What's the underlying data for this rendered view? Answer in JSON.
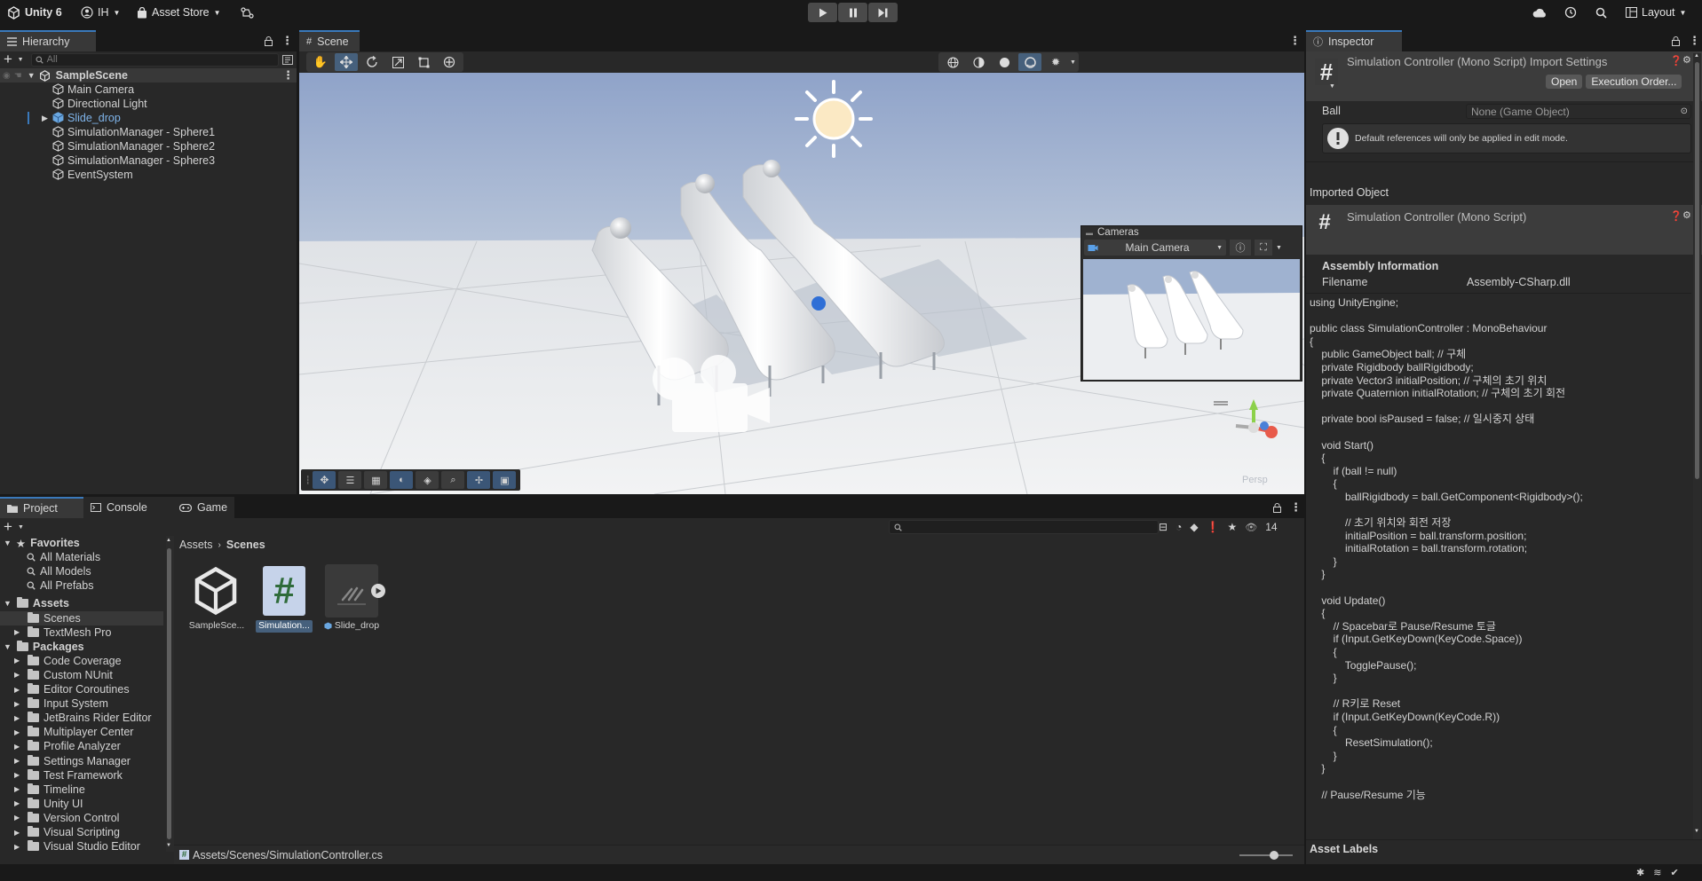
{
  "topbar": {
    "app_name": "Unity 6",
    "account": "IH",
    "asset_store": "Asset Store",
    "layout": "Layout"
  },
  "hierarchy": {
    "tab": "Hierarchy",
    "search_placeholder": "All",
    "scene_name": "SampleScene",
    "items": [
      {
        "label": "Main Camera"
      },
      {
        "label": "Directional Light"
      },
      {
        "label": "Slide_drop"
      },
      {
        "label": "SimulationManager - Sphere1"
      },
      {
        "label": "SimulationManager - Sphere2"
      },
      {
        "label": "SimulationManager - Sphere3"
      },
      {
        "label": "EventSystem"
      }
    ]
  },
  "scene": {
    "tab": "Scene",
    "cameras_overlay": {
      "title": "Cameras",
      "selected_camera": "Main Camera"
    },
    "persp_label": "Persp"
  },
  "inspector": {
    "tab": "Inspector",
    "header_title": "Simulation Controller (Mono Script) Import Settings",
    "open_button": "Open",
    "exec_order_button": "Execution Order...",
    "ball_label": "Ball",
    "ball_value": "None (Game Object)",
    "help_text": "Default references will only be applied in edit mode.",
    "imported_object": "Imported Object",
    "script_title": "Simulation Controller (Mono Script)",
    "assembly_info": "Assembly Information",
    "filename_label": "Filename",
    "filename_value": "Assembly-CSharp.dll",
    "code": "using UnityEngine;\n\npublic class SimulationController : MonoBehaviour\n{\n    public GameObject ball; // 구체\n    private Rigidbody ballRigidbody;\n    private Vector3 initialPosition; // 구체의 초기 위치\n    private Quaternion initialRotation; // 구체의 초기 회전\n\n    private bool isPaused = false; // 일시중지 상태\n\n    void Start()\n    {\n        if (ball != null)\n        {\n            ballRigidbody = ball.GetComponent<Rigidbody>();\n\n            // 초기 위치와 회전 저장\n            initialPosition = ball.transform.position;\n            initialRotation = ball.transform.rotation;\n        }\n    }\n\n    void Update()\n    {\n        // Spacebar로 Pause/Resume 토글\n        if (Input.GetKeyDown(KeyCode.Space))\n        {\n            TogglePause();\n        }\n\n        // R키로 Reset\n        if (Input.GetKeyDown(KeyCode.R))\n        {\n            ResetSimulation();\n        }\n    }\n\n    // Pause/Resume 기능",
    "asset_labels": "Asset Labels"
  },
  "project": {
    "tabs": [
      {
        "label": "Project"
      },
      {
        "label": "Console"
      },
      {
        "label": "Game"
      }
    ],
    "hidden_count": "14",
    "favorites": {
      "label": "Favorites",
      "items": [
        "All Materials",
        "All Models",
        "All Prefabs"
      ]
    },
    "assets": {
      "label": "Assets",
      "items": [
        "Scenes",
        "TextMesh Pro"
      ]
    },
    "packages": {
      "label": "Packages",
      "items": [
        "Code Coverage",
        "Custom NUnit",
        "Editor Coroutines",
        "Input System",
        "JetBrains Rider Editor",
        "Multiplayer Center",
        "Profile Analyzer",
        "Settings Manager",
        "Test Framework",
        "Timeline",
        "Unity UI",
        "Version Control",
        "Visual Scripting",
        "Visual Studio Editor"
      ]
    },
    "breadcrumb": {
      "root": "Assets",
      "current": "Scenes"
    },
    "files": [
      {
        "label": "SampleSce..."
      },
      {
        "label": "Simulation..."
      },
      {
        "label": "Slide_drop"
      }
    ],
    "selected_path": "Assets/Scenes/SimulationController.cs"
  },
  "colors": {
    "accent": "#3a79bb",
    "panel": "#282828",
    "toolbar": "#191919"
  }
}
